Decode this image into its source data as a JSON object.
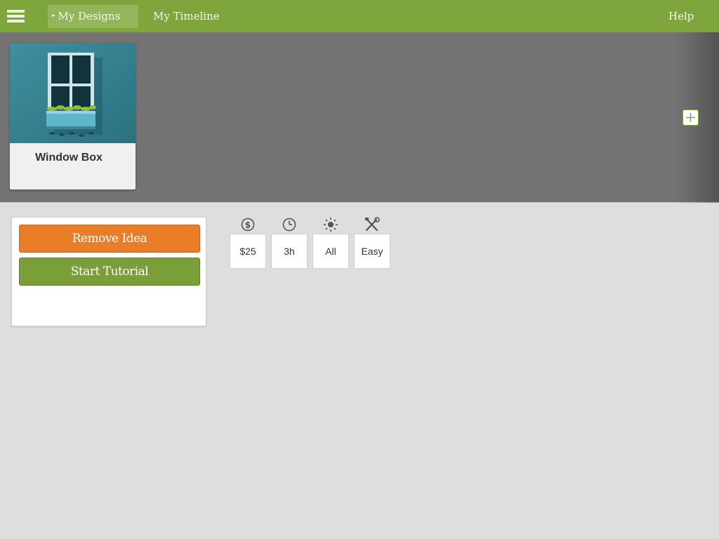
{
  "topbar": {
    "menu_icon": "hamburger-menu-icon",
    "nav": [
      {
        "label": "My Designs",
        "active": true
      },
      {
        "label": "My Timeline",
        "active": false
      }
    ],
    "help_label": "Help"
  },
  "gallery": {
    "cards": [
      {
        "title": "Window Box",
        "image": "window-box-thumbnail"
      }
    ],
    "add_icon": "plus-icon"
  },
  "actions": {
    "remove_label": "Remove Idea",
    "tutorial_label": "Start Tutorial"
  },
  "stats": [
    {
      "icon": "dollar-icon",
      "value": "$25"
    },
    {
      "icon": "clock-icon",
      "value": "3h"
    },
    {
      "icon": "sun-icon",
      "value": "All"
    },
    {
      "icon": "tools-icon",
      "value": "Easy"
    }
  ],
  "colors": {
    "brand_green": "#7fa53d",
    "remove_orange": "#ea7d27",
    "tutorial_green": "#7a9f3a",
    "gallery_bg": "#737373",
    "page_bg": "#dedede"
  }
}
